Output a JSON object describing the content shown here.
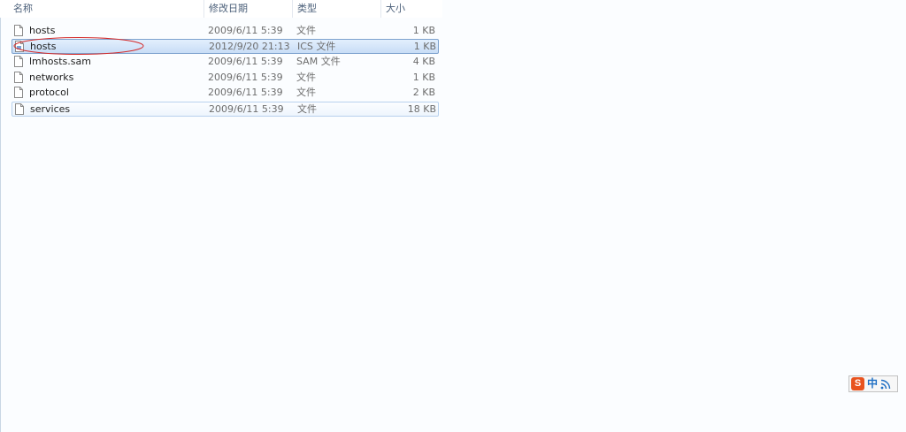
{
  "columns": {
    "name": "名称",
    "date": "修改日期",
    "type": "类型",
    "size": "大小"
  },
  "files": [
    {
      "name": "hosts",
      "date": "2009/6/11 5:39",
      "type": "文件",
      "size": "1 KB"
    },
    {
      "name": "hosts",
      "date": "2012/9/20 21:13",
      "type": "ICS 文件",
      "size": "1 KB"
    },
    {
      "name": "lmhosts.sam",
      "date": "2009/6/11 5:39",
      "type": "SAM 文件",
      "size": "4 KB"
    },
    {
      "name": "networks",
      "date": "2009/6/11 5:39",
      "type": "文件",
      "size": "1 KB"
    },
    {
      "name": "protocol",
      "date": "2009/6/11 5:39",
      "type": "文件",
      "size": "2 KB"
    },
    {
      "name": "services",
      "date": "2009/6/11 5:39",
      "type": "文件",
      "size": "18 KB"
    }
  ],
  "ime": {
    "logo": "S",
    "lang": "中",
    "icon": "feed-icon"
  },
  "colors": {
    "selection": "#cce0f8",
    "selection_border": "#7da2ce",
    "annotation": "#d42a2a",
    "ime_brand": "#e8531f"
  }
}
